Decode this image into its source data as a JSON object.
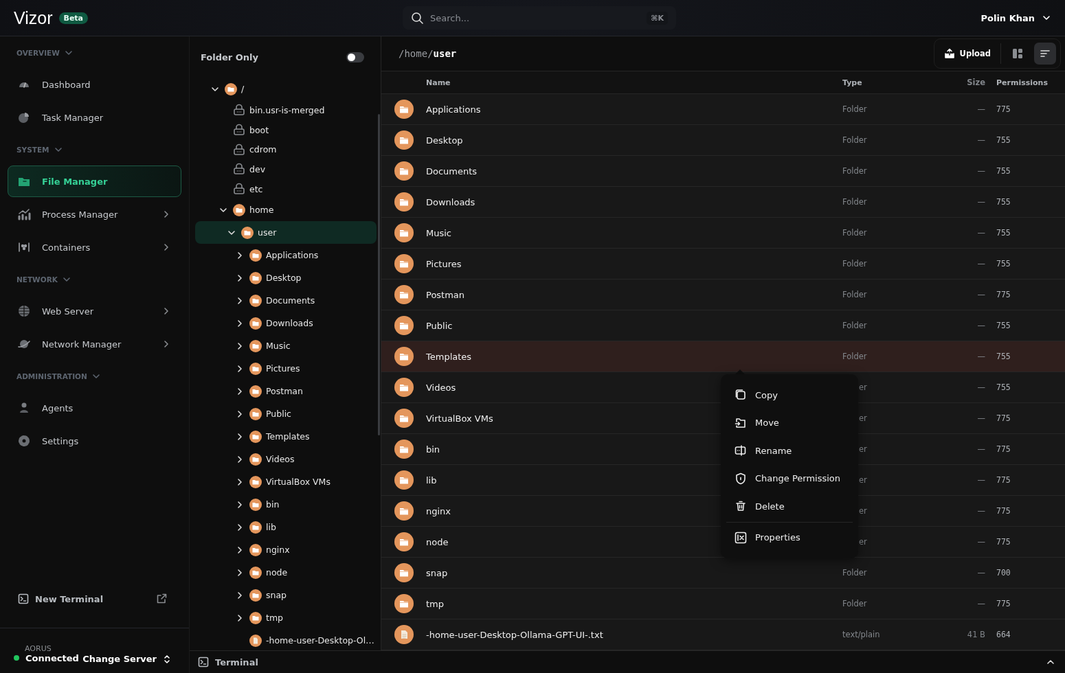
{
  "header": {
    "logo": "Vizor",
    "badge": "Beta",
    "search": {
      "placeholder": "Search...",
      "shortcut": "⌘K"
    },
    "user": "Polin Khan"
  },
  "sidebar": {
    "sections": [
      {
        "title": "OVERVIEW",
        "items": [
          {
            "label": "Dashboard",
            "selected": false,
            "submenu": false
          },
          {
            "label": "Task Manager",
            "selected": false,
            "submenu": false
          }
        ]
      },
      {
        "title": "SYSTEM",
        "items": [
          {
            "label": "File Manager",
            "selected": true,
            "submenu": false
          },
          {
            "label": "Process Manager",
            "selected": false,
            "submenu": true
          },
          {
            "label": "Containers",
            "selected": false,
            "submenu": true
          }
        ]
      },
      {
        "title": "NETWORK",
        "items": [
          {
            "label": "Web Server",
            "selected": false,
            "submenu": true
          },
          {
            "label": "Network Manager",
            "selected": false,
            "submenu": true
          }
        ]
      },
      {
        "title": "ADMINISTRATION",
        "items": [
          {
            "label": "Agents",
            "selected": false,
            "submenu": false
          },
          {
            "label": "Settings",
            "selected": false,
            "submenu": false
          }
        ]
      }
    ],
    "new_terminal": "New Terminal",
    "server": {
      "name": "AORUS",
      "status": "Connected",
      "connected": true,
      "change": "Change Server"
    }
  },
  "tree": {
    "folder_only": {
      "label": "Folder Only",
      "on": false
    },
    "items": [
      {
        "label": "/",
        "kind": "folder",
        "expanded": true,
        "selected": false,
        "children": [
          {
            "label": "bin.usr-is-merged",
            "kind": "drive",
            "selected": false
          },
          {
            "label": "boot",
            "kind": "drive",
            "selected": false
          },
          {
            "label": "cdrom",
            "kind": "drive",
            "selected": false
          },
          {
            "label": "dev",
            "kind": "drive",
            "selected": false
          },
          {
            "label": "etc",
            "kind": "drive",
            "selected": false
          },
          {
            "label": "home",
            "kind": "folder",
            "expanded": true,
            "selected": false,
            "children": [
              {
                "label": "user",
                "kind": "folder",
                "expanded": true,
                "selected": true,
                "children": [
                  {
                    "label": "Applications",
                    "kind": "folder",
                    "expanded": false,
                    "selected": false
                  },
                  {
                    "label": "Desktop",
                    "kind": "folder",
                    "expanded": false,
                    "selected": false
                  },
                  {
                    "label": "Documents",
                    "kind": "folder",
                    "expanded": false,
                    "selected": false
                  },
                  {
                    "label": "Downloads",
                    "kind": "folder",
                    "expanded": false,
                    "selected": false
                  },
                  {
                    "label": "Music",
                    "kind": "folder",
                    "expanded": false,
                    "selected": false
                  },
                  {
                    "label": "Pictures",
                    "kind": "folder",
                    "expanded": false,
                    "selected": false
                  },
                  {
                    "label": "Postman",
                    "kind": "folder",
                    "expanded": false,
                    "selected": false
                  },
                  {
                    "label": "Public",
                    "kind": "folder",
                    "expanded": false,
                    "selected": false
                  },
                  {
                    "label": "Templates",
                    "kind": "folder",
                    "expanded": false,
                    "selected": false
                  },
                  {
                    "label": "Videos",
                    "kind": "folder",
                    "expanded": false,
                    "selected": false
                  },
                  {
                    "label": "VirtualBox VMs",
                    "kind": "folder",
                    "expanded": false,
                    "selected": false
                  },
                  {
                    "label": "bin",
                    "kind": "folder",
                    "expanded": false,
                    "selected": false
                  },
                  {
                    "label": "lib",
                    "kind": "folder",
                    "expanded": false,
                    "selected": false
                  },
                  {
                    "label": "nginx",
                    "kind": "folder",
                    "expanded": false,
                    "selected": false
                  },
                  {
                    "label": "node",
                    "kind": "folder",
                    "expanded": false,
                    "selected": false
                  },
                  {
                    "label": "snap",
                    "kind": "folder",
                    "expanded": false,
                    "selected": false
                  },
                  {
                    "label": "tmp",
                    "kind": "folder",
                    "expanded": false,
                    "selected": false
                  },
                  {
                    "label": "-home-user-Desktop-Ol…",
                    "kind": "file",
                    "selected": false
                  }
                ]
              }
            ]
          }
        ]
      }
    ]
  },
  "main": {
    "path": "/home/**user**",
    "toolbar": {
      "upload": "Upload",
      "views": [
        {
          "selected": false
        },
        {
          "selected": true
        }
      ]
    },
    "table": {
      "columns": [
        "Name",
        "Type",
        "Size",
        "Permissions"
      ],
      "rows": [
        {
          "kind": "folder",
          "name": "Applications",
          "type": "Folder",
          "size": "—",
          "permissions": "775",
          "selected": false
        },
        {
          "kind": "folder",
          "name": "Desktop",
          "type": "Folder",
          "size": "—",
          "permissions": "755",
          "selected": false
        },
        {
          "kind": "folder",
          "name": "Documents",
          "type": "Folder",
          "size": "—",
          "permissions": "755",
          "selected": false
        },
        {
          "kind": "folder",
          "name": "Downloads",
          "type": "Folder",
          "size": "—",
          "permissions": "755",
          "selected": false
        },
        {
          "kind": "folder",
          "name": "Music",
          "type": "Folder",
          "size": "—",
          "permissions": "755",
          "selected": false
        },
        {
          "kind": "folder",
          "name": "Pictures",
          "type": "Folder",
          "size": "—",
          "permissions": "755",
          "selected": false
        },
        {
          "kind": "folder",
          "name": "Postman",
          "type": "Folder",
          "size": "—",
          "permissions": "775",
          "selected": false
        },
        {
          "kind": "folder",
          "name": "Public",
          "type": "Folder",
          "size": "—",
          "permissions": "755",
          "selected": false
        },
        {
          "kind": "folder",
          "name": "Templates",
          "type": "Folder",
          "size": "—",
          "permissions": "755",
          "selected": true
        },
        {
          "kind": "folder",
          "name": "Videos",
          "type": "er",
          "type_covered": true,
          "size": "—",
          "permissions": "755",
          "selected": false
        },
        {
          "kind": "folder",
          "name": "VirtualBox VMs",
          "type": "er",
          "type_covered": true,
          "size": "—",
          "permissions": "775",
          "selected": false
        },
        {
          "kind": "folder",
          "name": "bin",
          "type": "er",
          "type_covered": true,
          "size": "—",
          "permissions": "775",
          "selected": false
        },
        {
          "kind": "folder",
          "name": "lib",
          "type": "er",
          "type_covered": true,
          "size": "—",
          "permissions": "775",
          "selected": false
        },
        {
          "kind": "folder",
          "name": "nginx",
          "type": "er",
          "type_covered": true,
          "size": "—",
          "permissions": "775",
          "selected": false
        },
        {
          "kind": "folder",
          "name": "node",
          "type": "er",
          "type_covered": true,
          "size": "—",
          "permissions": "775",
          "selected": false
        },
        {
          "kind": "folder",
          "name": "snap",
          "type": "Folder",
          "size": "—",
          "permissions": "700",
          "selected": false
        },
        {
          "kind": "folder",
          "name": "tmp",
          "type": "Folder",
          "size": "—",
          "permissions": "775",
          "selected": false
        },
        {
          "kind": "file",
          "name": "-home-user-Desktop-Ollama-GPT-UI-.txt",
          "type": "text/plain",
          "size": "41 B",
          "permissions": "664",
          "selected": false
        }
      ]
    },
    "context_menu": {
      "groups": [
        [
          "Copy",
          "Move",
          "Rename",
          "Change Permission",
          "Delete"
        ],
        [
          "Properties"
        ]
      ]
    }
  },
  "terminal_bar": {
    "label": "Terminal",
    "expanded": false
  }
}
